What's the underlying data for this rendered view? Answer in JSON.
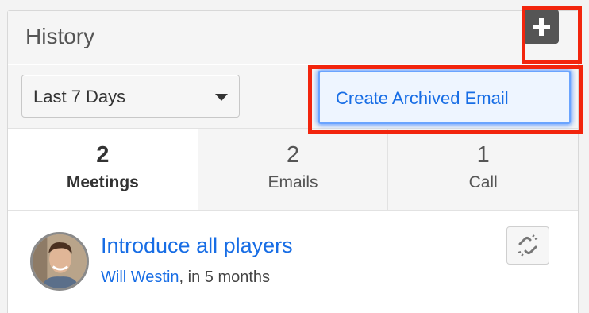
{
  "dashlet": {
    "title": "History",
    "add_button_icon": "plus-icon"
  },
  "filter": {
    "selected": "Last 7 Days"
  },
  "menu": {
    "create_archived_email": "Create Archived Email"
  },
  "tabs": [
    {
      "count": "2",
      "label": "Meetings",
      "active": true
    },
    {
      "count": "2",
      "label": "Emails",
      "active": false
    },
    {
      "count": "1",
      "label": "Call",
      "active": false
    }
  ],
  "items": [
    {
      "title": "Introduce all players",
      "person": "Will Westin",
      "suffix": ", in 5 months",
      "action_icon": "unlink-icon"
    }
  ],
  "colors": {
    "link": "#176de5",
    "highlight": "#f2250d",
    "add_button": "#555555"
  }
}
